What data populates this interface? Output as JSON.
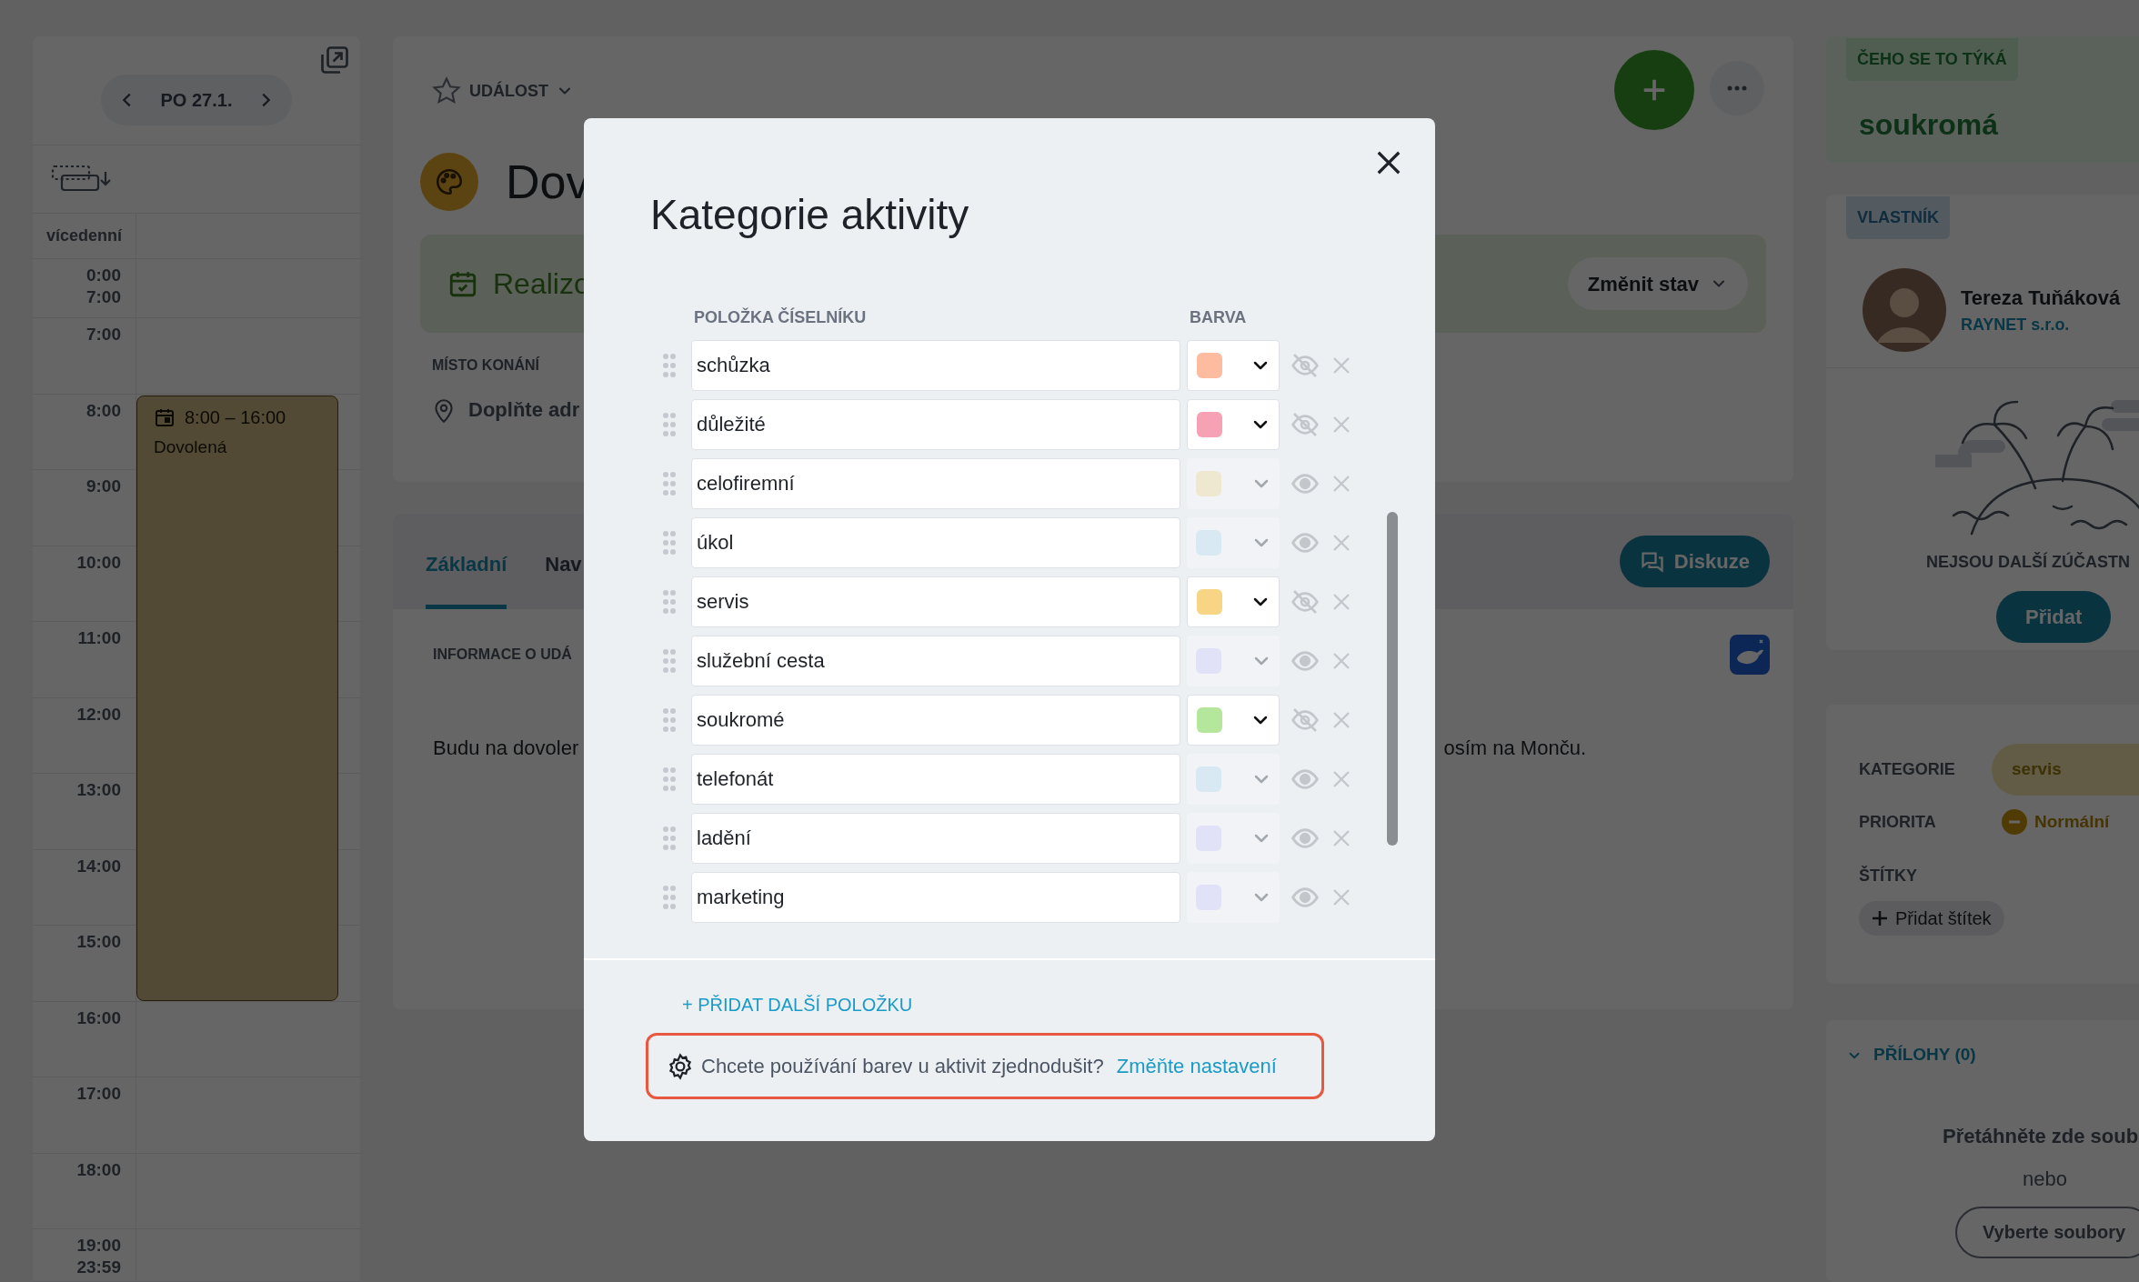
{
  "calendar": {
    "date": "PO 27.1.",
    "multi_day_label": "vícedenní",
    "time_rows": [
      {
        "lines": [
          "0:00",
          "7:00"
        ]
      },
      {
        "lines": [
          "7:00"
        ]
      },
      {
        "lines": [
          "8:00"
        ]
      },
      {
        "lines": [
          "9:00"
        ]
      },
      {
        "lines": [
          "10:00"
        ]
      },
      {
        "lines": [
          "11:00"
        ]
      },
      {
        "lines": [
          "12:00"
        ]
      },
      {
        "lines": [
          "13:00"
        ]
      },
      {
        "lines": [
          "14:00"
        ]
      },
      {
        "lines": [
          "15:00"
        ]
      },
      {
        "lines": [
          "16:00"
        ]
      },
      {
        "lines": [
          "17:00"
        ]
      },
      {
        "lines": [
          "18:00"
        ]
      },
      {
        "lines": [
          "19:00",
          "23:59"
        ]
      }
    ],
    "event": {
      "time": "8:00 – 16:00",
      "title": "Dovolená"
    }
  },
  "event_detail": {
    "type_label": "UDÁLOST",
    "title": "Dov",
    "status": "Realizo",
    "change_status_button": "Změnit stav",
    "location_label": "MÍSTO KONÁNÍ",
    "location_placeholder": "Doplňte adr",
    "tabs": [
      {
        "label": "Základní",
        "selected": true
      },
      {
        "label": "Nav",
        "selected": false
      }
    ],
    "discussion_button": "Diskuze",
    "info_heading": "INFORMACE O UDÁ",
    "description_start": "Budu na dovoler",
    "description_end": "osím na Monču."
  },
  "sidebar": {
    "relates_label": "ČEHO SE TO TÝKÁ",
    "relates_value": "soukromá",
    "owner_label": "VLASTNÍK",
    "owner_name": "Tereza Tuňáková",
    "owner_company": "RAYNET s.r.o.",
    "no_participants": "NEJSOU DALŠÍ ZÚČASTN",
    "add_participant_button": "Přidat",
    "category_label": "KATEGORIE",
    "category_value": "servis",
    "priority_label": "PRIORITA",
    "priority_value": "Normální",
    "tags_label": "ŠTÍTKY",
    "add_tag_button": "Přidat štítek",
    "attachments_label": "PŘÍLOHY (0)",
    "drop_hint": "Přetáhněte zde soub",
    "or_text": "nebo",
    "choose_files_button": "Vyberte soubory"
  },
  "dialog": {
    "title": "Kategorie aktivity",
    "column_item": "POLOŽKA ČÍSELNÍKU",
    "column_color": "BARVA",
    "items": [
      {
        "name": "schůzka",
        "color": "#fdbb9f",
        "active": true
      },
      {
        "name": "důležité",
        "color": "#f7a1b4",
        "active": true
      },
      {
        "name": "celofiremní",
        "color": "#ede8cf",
        "active": false
      },
      {
        "name": "úkol",
        "color": "#d9e9f3",
        "active": false
      },
      {
        "name": "servis",
        "color": "#f7d584",
        "active": true
      },
      {
        "name": "služební cesta",
        "color": "#e1e2f7",
        "active": false
      },
      {
        "name": "soukromé",
        "color": "#b4e79c",
        "active": true
      },
      {
        "name": "telefonát",
        "color": "#d9e9f3",
        "active": false
      },
      {
        "name": "ladění",
        "color": "#e1e2f7",
        "active": false
      },
      {
        "name": "marketing",
        "color": "#e1e2f7",
        "active": false
      }
    ],
    "add_item": "+ PŘIDAT DALŠÍ POLOŽKU",
    "hint": "Chcete používání barev u aktivit zjednodušit?",
    "hint_link": "Změňte nastavení"
  }
}
